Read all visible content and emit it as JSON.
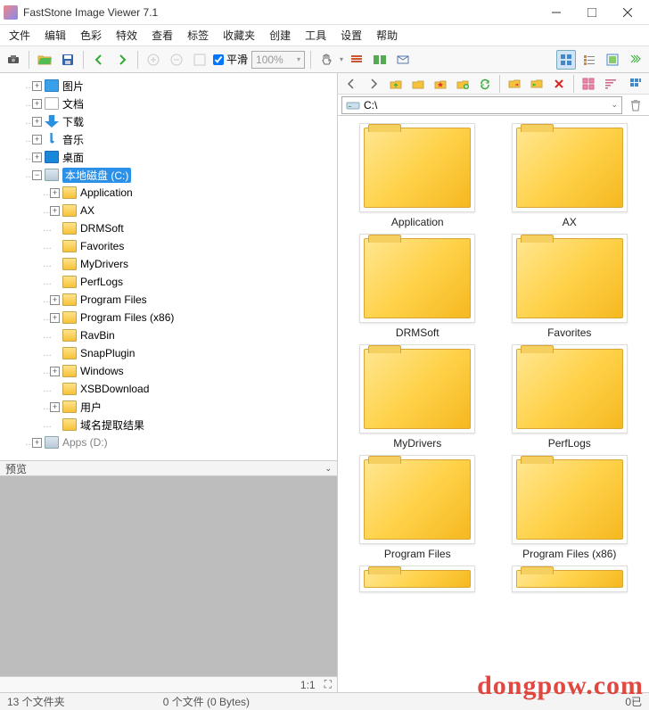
{
  "app": {
    "title": "FastStone Image Viewer 7.1"
  },
  "menu": [
    "文件",
    "编辑",
    "色彩",
    "特效",
    "查看",
    "标签",
    "收藏夹",
    "创建",
    "工具",
    "设置",
    "帮助"
  ],
  "toolbar": {
    "smooth_label": "平滑",
    "zoom": "100%"
  },
  "tree": [
    {
      "depth": 1,
      "exp": "+",
      "icon": "pic",
      "label": "图片"
    },
    {
      "depth": 1,
      "exp": "+",
      "icon": "doc",
      "label": "文档"
    },
    {
      "depth": 1,
      "exp": "+",
      "icon": "down",
      "label": "下载"
    },
    {
      "depth": 1,
      "exp": "+",
      "icon": "music",
      "label": "音乐"
    },
    {
      "depth": 1,
      "exp": "+",
      "icon": "desk",
      "label": "桌面"
    },
    {
      "depth": 1,
      "exp": "-",
      "icon": "drive",
      "label": "本地磁盘 (C:)",
      "selected": true
    },
    {
      "depth": 2,
      "exp": "+",
      "icon": "folder",
      "label": "Application"
    },
    {
      "depth": 2,
      "exp": "+",
      "icon": "folder",
      "label": "AX"
    },
    {
      "depth": 2,
      "exp": "",
      "icon": "folder",
      "label": "DRMSoft"
    },
    {
      "depth": 2,
      "exp": "",
      "icon": "folder",
      "label": "Favorites"
    },
    {
      "depth": 2,
      "exp": "",
      "icon": "folder",
      "label": "MyDrivers"
    },
    {
      "depth": 2,
      "exp": "",
      "icon": "folder",
      "label": "PerfLogs"
    },
    {
      "depth": 2,
      "exp": "+",
      "icon": "folder",
      "label": "Program Files"
    },
    {
      "depth": 2,
      "exp": "+",
      "icon": "folder",
      "label": "Program Files (x86)"
    },
    {
      "depth": 2,
      "exp": "",
      "icon": "folder",
      "label": "RavBin"
    },
    {
      "depth": 2,
      "exp": "",
      "icon": "folder",
      "label": "SnapPlugin"
    },
    {
      "depth": 2,
      "exp": "+",
      "icon": "folder",
      "label": "Windows"
    },
    {
      "depth": 2,
      "exp": "",
      "icon": "folder",
      "label": "XSBDownload"
    },
    {
      "depth": 2,
      "exp": "+",
      "icon": "folder",
      "label": "用户"
    },
    {
      "depth": 2,
      "exp": "",
      "icon": "folder",
      "label": "域名提取结果"
    },
    {
      "depth": 1,
      "exp": "+",
      "icon": "drive",
      "label": "Apps (D:)",
      "cut": true
    }
  ],
  "preview": {
    "title": "预览",
    "ratio": "1:1"
  },
  "path": "C:\\",
  "thumbs": [
    "Application",
    "AX",
    "DRMSoft",
    "Favorites",
    "MyDrivers",
    "PerfLogs",
    "Program Files",
    "Program Files (x86)"
  ],
  "status": {
    "folders": "13 个文件夹",
    "files": "0 个文件 (0 Bytes)",
    "sel": "0已"
  },
  "watermark": "dongpow.com"
}
